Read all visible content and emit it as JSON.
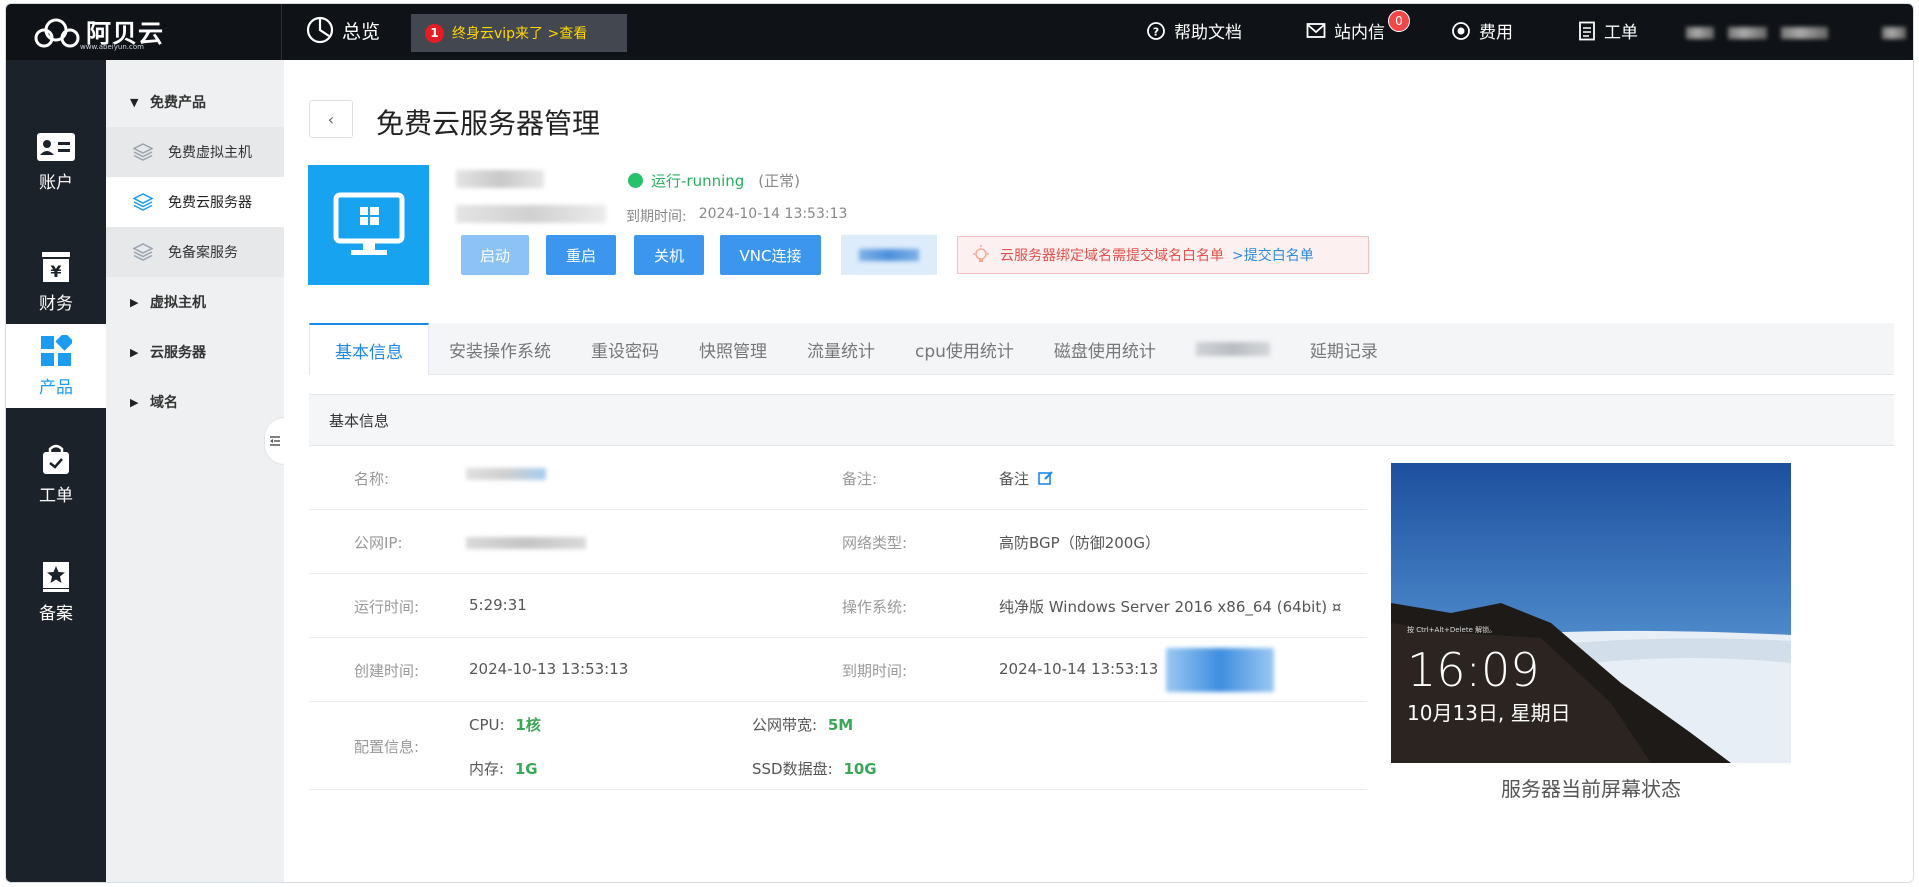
{
  "topbar": {
    "logo_text": "阿贝云",
    "logo_sub": "www.abeiyun.com",
    "overview_label": "总览",
    "vip_count": "1",
    "vip_text": "终身云vip来了 >查看",
    "help_label": "帮助文档",
    "mail_label": "站内信",
    "mail_badge": "0",
    "fee_label": "费用",
    "ticket_label": "工单"
  },
  "sidebar_primary": [
    {
      "label": "账户",
      "icon": "id-card-icon"
    },
    {
      "label": "财务",
      "icon": "yen-icon"
    },
    {
      "label": "产品",
      "icon": "grid-icon"
    },
    {
      "label": "工单",
      "icon": "bag-icon"
    },
    {
      "label": "备案",
      "icon": "star-badge-icon"
    }
  ],
  "sidebar_secondary": {
    "group_free": "免费产品",
    "free_items": [
      "免费虚拟主机",
      "免费云服务器",
      "免备案服务"
    ],
    "group_vhost": "虚拟主机",
    "group_cloud": "云服务器",
    "group_domain": "域名"
  },
  "page": {
    "title": "免费云服务器管理",
    "status": "运行-running",
    "status_note": "(正常)",
    "expire_label": "到期时间:",
    "expire_value": "2024-10-14 13:53:13"
  },
  "actions": {
    "start": "启动",
    "restart": "重启",
    "shutdown": "关机",
    "vnc": "VNC连接"
  },
  "notice": {
    "text": "云服务器绑定域名需提交域名白名单",
    "link": ">提交白名单"
  },
  "tabs": [
    "基本信息",
    "安装操作系统",
    "重设密码",
    "快照管理",
    "流量统计",
    "cpu使用统计",
    "磁盘使用统计",
    "延期记录"
  ],
  "section_title": "基本信息",
  "info": {
    "name_label": "名称:",
    "remark_label": "备注:",
    "remark_value": "备注",
    "ip_label": "公网IP:",
    "net_label": "网络类型:",
    "net_value": "高防BGP（防御200G）",
    "uptime_label": "运行时间:",
    "uptime_value": "5:29:31",
    "os_label": "操作系统:",
    "os_value": "纯净版 Windows Server 2016 x86_64 (64bit) ¤",
    "created_label": "创建时间:",
    "created_value": "2024-10-13 13:53:13",
    "expire_label": "到期时间:",
    "expire_value": "2024-10-14 13:53:13",
    "config_label": "配置信息:",
    "cpu_label": "CPU:",
    "cpu_value": "1核",
    "bandwidth_label": "公网带宽:",
    "bandwidth_value": "5M",
    "mem_label": "内存:",
    "mem_value": "1G",
    "disk_label": "SSD数据盘:",
    "disk_value": "10G"
  },
  "screen": {
    "hint": "按 Ctrl+Alt+Delete 解锁。",
    "time": "16:09",
    "date": "10月13日, 星期日",
    "caption": "服务器当前屏幕状态"
  },
  "colors": {
    "accent": "#1e88e5",
    "status_green": "#27c26b",
    "topbar": "#0f1216",
    "sidebar": "#1c2229"
  }
}
